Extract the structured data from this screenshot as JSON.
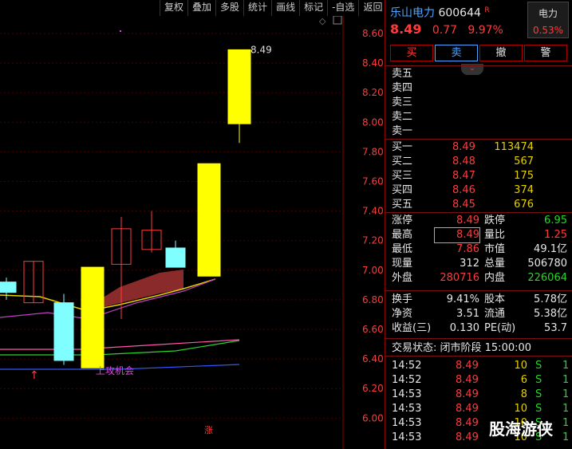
{
  "toolbar": [
    "复权",
    "叠加",
    "多股",
    "统计",
    "画线",
    "标记",
    "-自选",
    "返回"
  ],
  "stock": {
    "name": "乐山电力",
    "code": "600644",
    "flag": "R",
    "price": "8.49",
    "change": "0.77",
    "pct": "9.97%",
    "sector": "电力",
    "sector_pct": "0.53%"
  },
  "actions": [
    "买",
    "卖",
    "撤",
    "警"
  ],
  "sell_labels": [
    "卖五",
    "卖四",
    "卖三",
    "卖二",
    "卖一"
  ],
  "buy": [
    [
      "买一",
      "8.49",
      "113474"
    ],
    [
      "买二",
      "8.48",
      "567"
    ],
    [
      "买三",
      "8.47",
      "175"
    ],
    [
      "买四",
      "8.46",
      "374"
    ],
    [
      "买五",
      "8.45",
      "676"
    ]
  ],
  "stats": [
    [
      "涨停",
      "8.49",
      "跌停",
      "6.95"
    ],
    [
      "最高",
      "8.49",
      "量比",
      "1.25"
    ],
    [
      "最低",
      "7.86",
      "市值",
      "49.1亿"
    ],
    [
      "现量",
      "312",
      "总量",
      "506780"
    ],
    [
      "外盘",
      "280716",
      "内盘",
      "226064"
    ]
  ],
  "fund": [
    [
      "换手",
      "9.41%",
      "股本",
      "5.78亿"
    ],
    [
      "净资",
      "3.51",
      "流通",
      "5.38亿"
    ],
    [
      "收益(三)",
      "0.130",
      "PE(动)",
      "53.7"
    ]
  ],
  "status_line": "交易状态: 闭市阶段 15:00:00",
  "ticks": [
    [
      "14:52",
      "8.49",
      "10",
      "S",
      "1"
    ],
    [
      "14:52",
      "8.49",
      "6",
      "S",
      "1"
    ],
    [
      "14:53",
      "8.49",
      "8",
      "S",
      "1"
    ],
    [
      "14:53",
      "8.49",
      "10",
      "S",
      "1"
    ],
    [
      "14:53",
      "8.49",
      "10",
      "S",
      "1"
    ],
    [
      "14:53",
      "8.49",
      "10",
      "S",
      "1"
    ]
  ],
  "watermark": "股海游侠",
  "chart_data": {
    "type": "candlestick",
    "y_ticks": [
      "8.60",
      "8.40",
      "8.20",
      "8.00",
      "7.80",
      "7.60",
      "7.40",
      "7.20",
      "7.00",
      "6.80",
      "6.60",
      "6.40",
      "6.20",
      "6.00"
    ],
    "last_label": "8.49",
    "annotation": "上攻机会",
    "limit_mark": "涨"
  }
}
